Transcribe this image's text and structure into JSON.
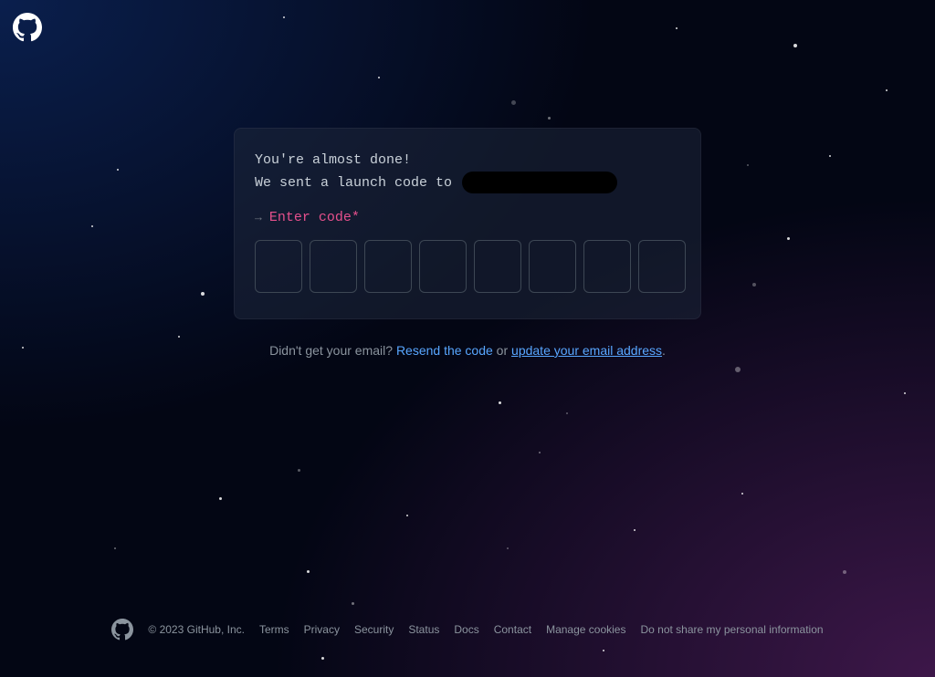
{
  "brand": {
    "name": "GitHub"
  },
  "card": {
    "heading_line1": "You're almost done!",
    "heading_line2_prefix": "We sent a launch code to ",
    "email_redacted": true,
    "prompt_label": "Enter code",
    "required_marker": "*",
    "code_length": 8
  },
  "below": {
    "prefix": "Didn't get your email? ",
    "resend_label": "Resend the code",
    "middle": " or ",
    "update_label": "update your email address",
    "suffix": "."
  },
  "footer": {
    "copyright": "© 2023 GitHub, Inc.",
    "links": {
      "terms": "Terms",
      "privacy": "Privacy",
      "security": "Security",
      "status": "Status",
      "docs": "Docs",
      "contact": "Contact",
      "manage_cookies": "Manage cookies",
      "do_not_share": "Do not share my personal information"
    }
  },
  "colors": {
    "accent_pink": "#e6508c",
    "link_blue": "#58a6ff"
  }
}
